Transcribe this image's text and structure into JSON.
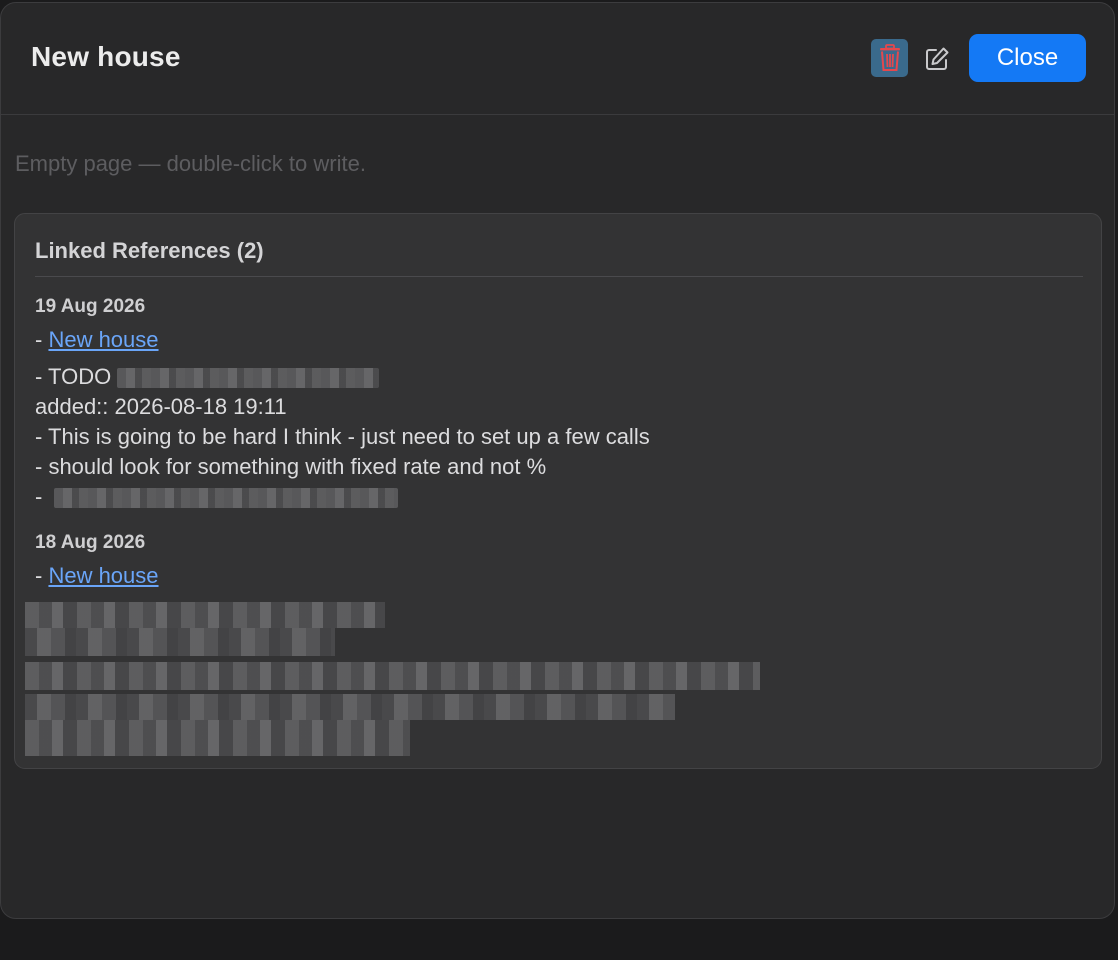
{
  "window": {
    "title": "New house",
    "close_label": "Close",
    "empty_hint": "Empty page — double-click to write."
  },
  "linked_references": {
    "heading": "Linked References (2)",
    "groups": [
      {
        "date": "19 Aug 2026",
        "link_prefix": "- ",
        "link": "New house",
        "lines": [
          "- TODO",
          "added:: 2026-08-18 19:11",
          "- This is going to be hard I think - just need to set up a few calls",
          "- should look for something with fixed rate and not %",
          "-"
        ]
      },
      {
        "date": "18 Aug 2026",
        "link_prefix": "- ",
        "link": "New house"
      }
    ]
  },
  "colors": {
    "accent": "#1479f5",
    "link": "#6aa5f8",
    "trash": "#e5484d"
  },
  "icons": {
    "trash": "trash-icon",
    "edit": "edit-icon"
  }
}
